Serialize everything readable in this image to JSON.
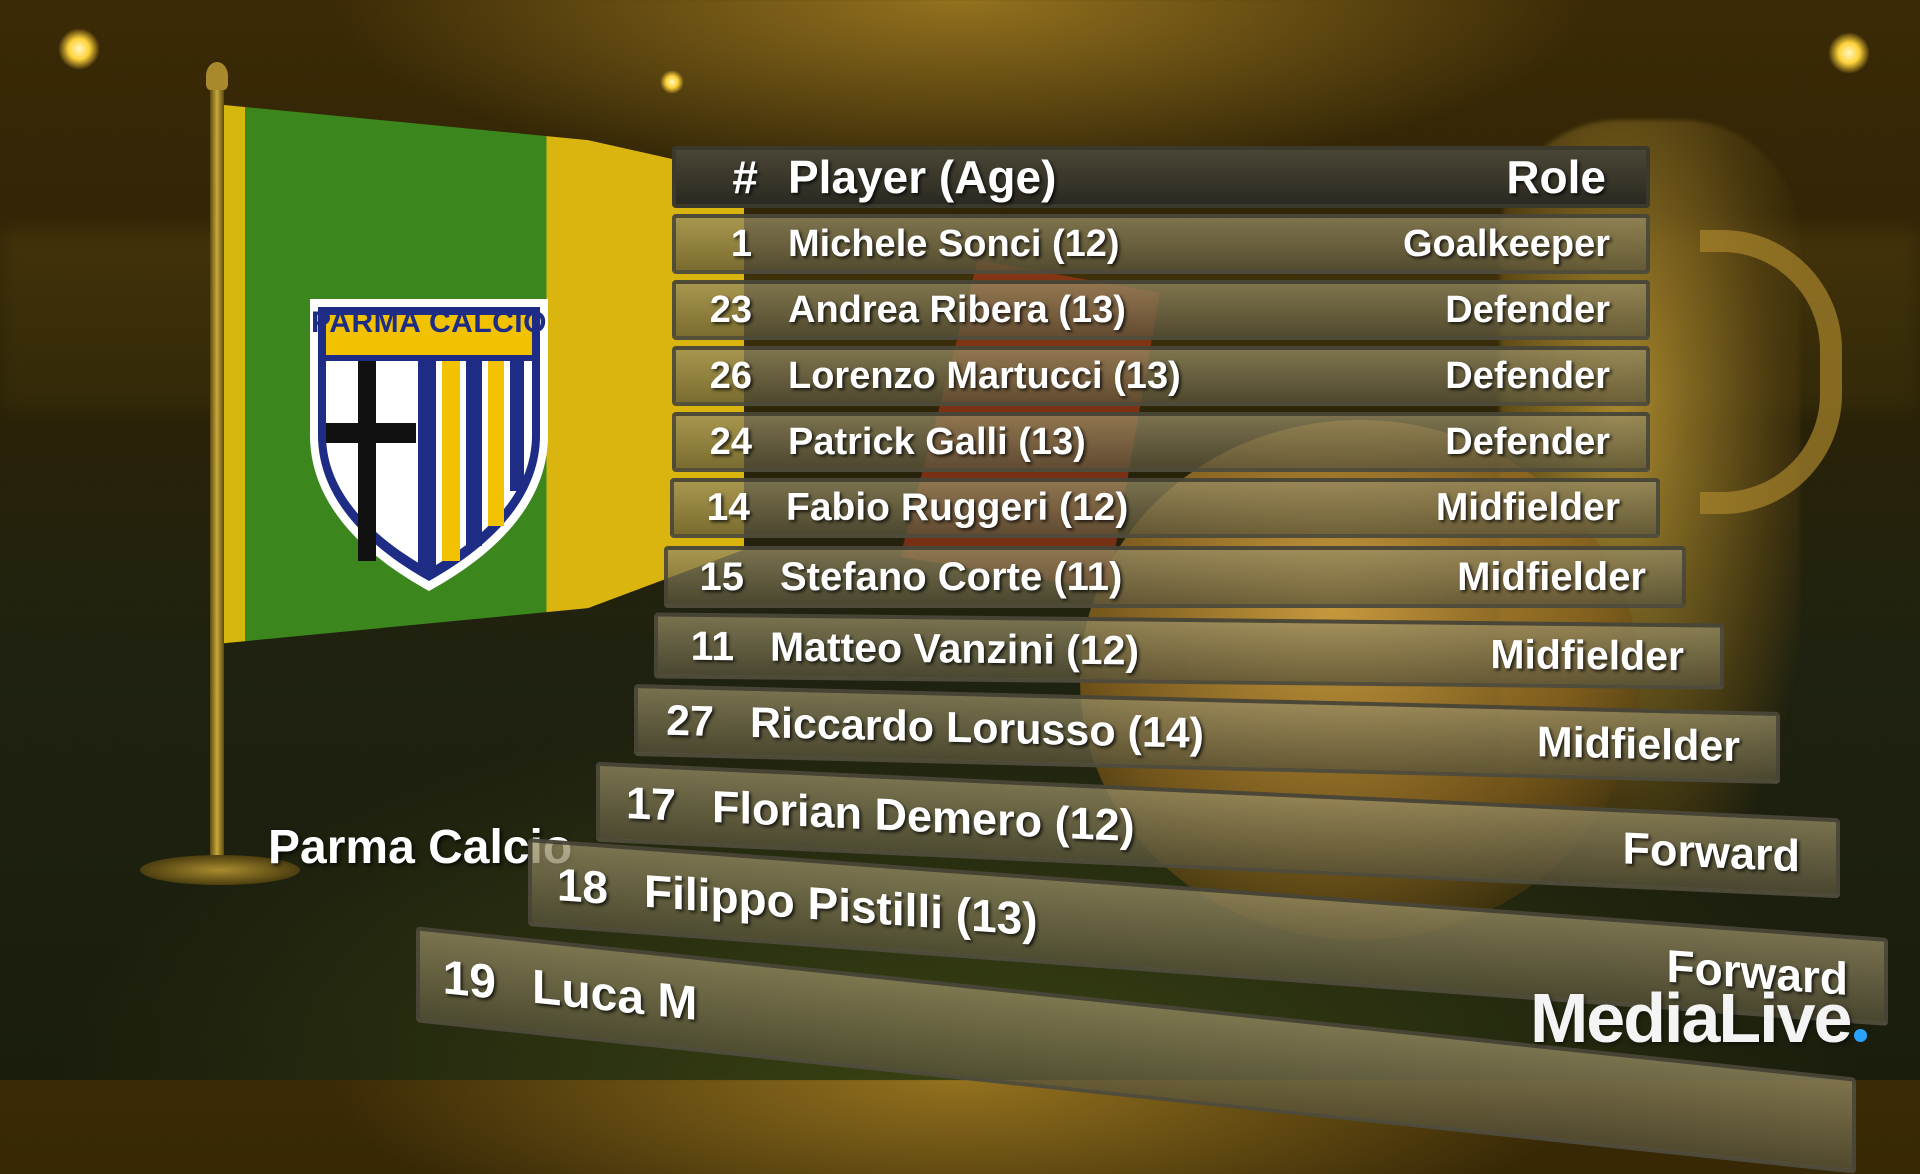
{
  "colors": {
    "flag_green": "#3f8e1e",
    "flag_yellow": "#e6bf10",
    "crest_blue": "#1e2c86",
    "crest_yellow": "#f2c200",
    "watermark_dot": "#2aa3ff"
  },
  "flag": {
    "crest_text": "PARMA CALCIO",
    "caption": "Parma Calcio"
  },
  "table": {
    "header": {
      "number": "#",
      "player": "Player (Age)",
      "role": "Role"
    },
    "rows": [
      {
        "number": "1",
        "player": "Michele Sonci (12)",
        "role": "Goalkeeper"
      },
      {
        "number": "23",
        "player": "Andrea Ribera (13)",
        "role": "Defender"
      },
      {
        "number": "26",
        "player": "Lorenzo Martucci (13)",
        "role": "Defender"
      },
      {
        "number": "24",
        "player": "Patrick Galli (13)",
        "role": "Defender"
      },
      {
        "number": "14",
        "player": "Fabio Ruggeri (12)",
        "role": "Midfielder"
      },
      {
        "number": "15",
        "player": "Stefano Corte (11)",
        "role": "Midfielder"
      },
      {
        "number": "11",
        "player": "Matteo Vanzini (12)",
        "role": "Midfielder"
      },
      {
        "number": "27",
        "player": "Riccardo Lorusso (14)",
        "role": "Midfielder"
      },
      {
        "number": "17",
        "player": "Florian Demero (12)",
        "role": "Forward"
      },
      {
        "number": "18",
        "player": "Filippo Pistilli (13)",
        "role": "Forward"
      },
      {
        "number": "19",
        "player": "Luca M",
        "role": ""
      }
    ]
  },
  "watermark": {
    "text": "MediaLive"
  }
}
